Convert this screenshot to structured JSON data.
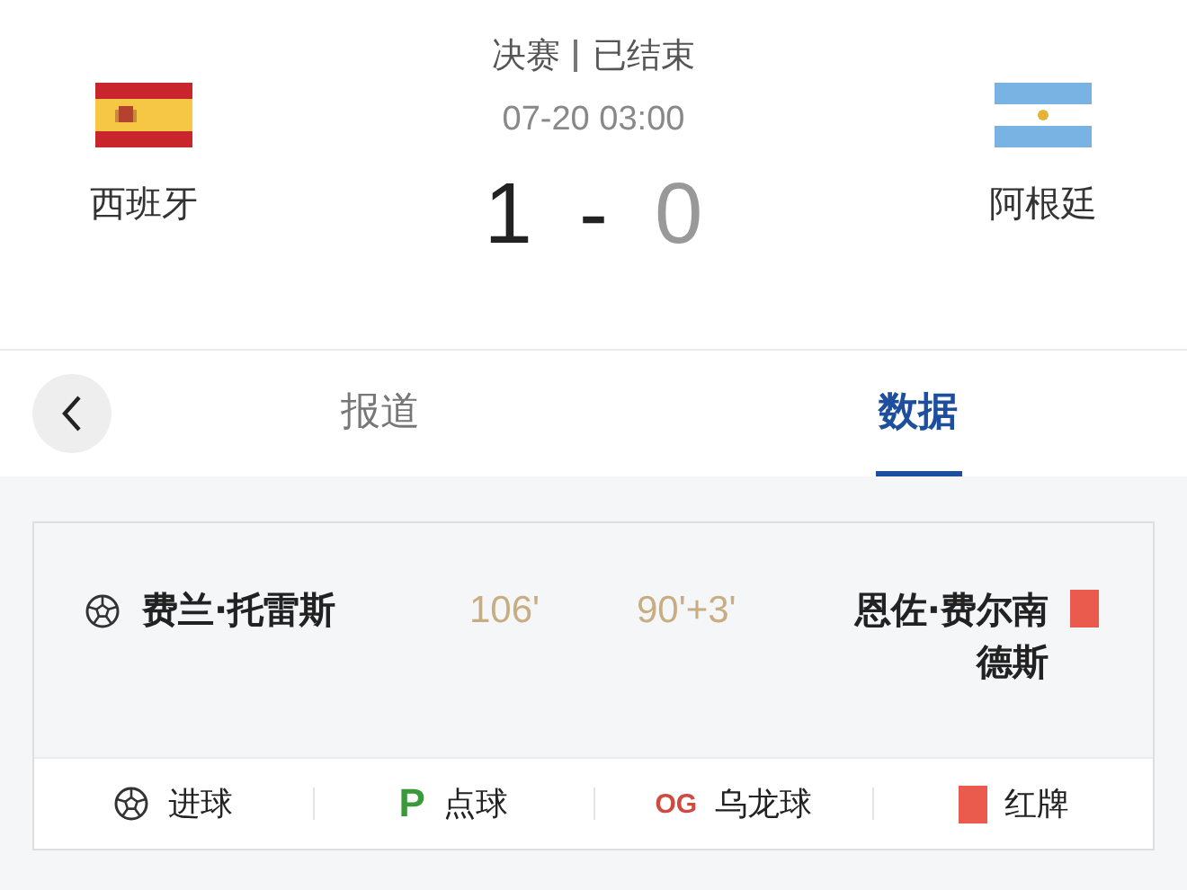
{
  "match": {
    "stage": "决赛",
    "status": "已结束",
    "time": "07-20 03:00",
    "home": {
      "name": "西班牙",
      "score": "1",
      "winner": true
    },
    "away": {
      "name": "阿根廷",
      "score": "0",
      "winner": false
    },
    "separator": "-"
  },
  "tabs": [
    {
      "label": "报道",
      "selected": false
    },
    {
      "label": "数据",
      "selected": true
    }
  ],
  "events": [
    {
      "home": {
        "kind": "goal",
        "player": "费兰·托雷斯",
        "minute": "106'"
      },
      "away": {
        "kind": "red_card",
        "player": "恩佐·费尔南德斯",
        "minute": "90'+3'"
      }
    }
  ],
  "legend": [
    {
      "kind": "goal",
      "label": "进球"
    },
    {
      "kind": "penalty",
      "symbol": "P",
      "label": "点球"
    },
    {
      "kind": "own_goal",
      "symbol": "OG",
      "label": "乌龙球"
    },
    {
      "kind": "red_card",
      "label": "红牌"
    }
  ]
}
